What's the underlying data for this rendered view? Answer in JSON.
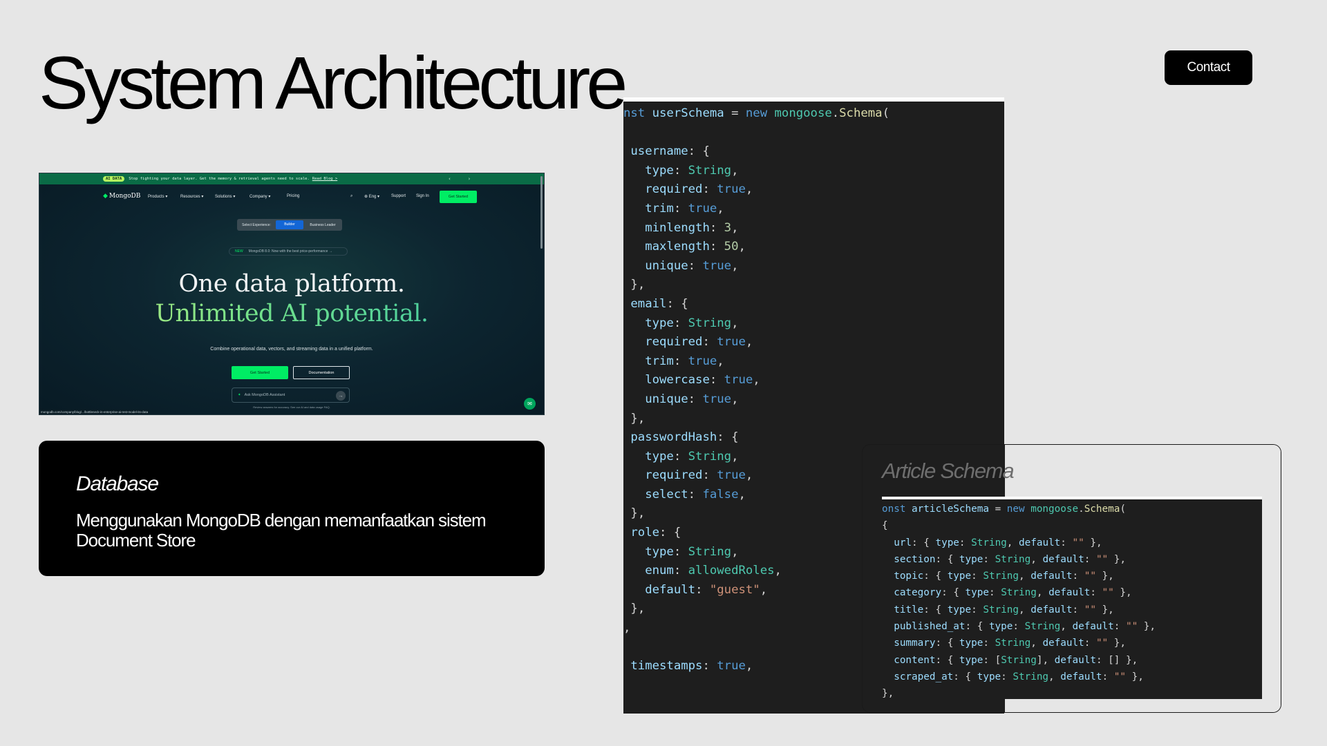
{
  "slide": {
    "title": "System Architecture",
    "contact_label": "Contact"
  },
  "mongodb_screenshot": {
    "banner_pill": "AI DATA",
    "banner_text": "Stop fighting your data layer. Get the memory & retrieval agents need to scale.",
    "banner_link": "Read Blog >",
    "banner_arrows": "‹ ›",
    "logo": "MongoDB",
    "nav_items": [
      "Products ▾",
      "Resources ▾",
      "Solutions ▾",
      "Company ▾",
      "Pricing"
    ],
    "nav_right": [
      "⌕",
      "⊕ Eng ▾",
      "Support",
      "Sign In"
    ],
    "nav_cta": "Get Started",
    "toggle": [
      "Select Experience:",
      "Builder",
      "Business Leader"
    ],
    "news_tag": "NEW",
    "news_text": "MongoDB 8.0: Now with the best price-performance →",
    "headline_1": "One data platform.",
    "headline_2": "Unlimited AI potential.",
    "subheadline": "Combine operational data, vectors, and streaming data in a unified platform.",
    "primary_button": "Get Started",
    "secondary_button": "Documentation",
    "ask_placeholder": "Ask MongoDB Assistant",
    "ask_send": "→",
    "disclaimer": "Review answers for accuracy. See our AI and data usage FAQ.",
    "status_url": "mongodb.com/company/blog/.../bottleneck-in-enterprise-ai-rest-model-its-data",
    "chat_icon": "chat-bubble-icon"
  },
  "database_card": {
    "title": "Database",
    "description": "Menggunakan MongoDB dengan memanfaatkan sistem Document Store"
  },
  "user_schema_code": [
    "nst userSchema = new mongoose.Schema(",
    "",
    " username: {",
    "   type: String,",
    "   required: true,",
    "   trim: true,",
    "   minlength: 3,",
    "   maxlength: 50,",
    "   unique: true,",
    " },",
    " email: {",
    "   type: String,",
    "   required: true,",
    "   trim: true,",
    "   lowercase: true,",
    "   unique: true,",
    " },",
    " passwordHash: {",
    "   type: String,",
    "   required: true,",
    "   select: false,",
    " },",
    " role: {",
    "   type: String,",
    "   enum: allowedRoles,",
    "   default: \"guest\",",
    " },",
    ",",
    "",
    " timestamps: true,"
  ],
  "article_card": {
    "title": "Article Schema",
    "code": [
      "onst articleSchema = new mongoose.Schema(",
      "{",
      "  url: { type: String, default: \"\" },",
      "  section: { type: String, default: \"\" },",
      "  topic: { type: String, default: \"\" },",
      "  category: { type: String, default: \"\" },",
      "  title: { type: String, default: \"\" },",
      "  published_at: { type: String, default: \"\" },",
      "  summary: { type: String, default: \"\" },",
      "  content: { type: [String], default: [] },",
      "  scraped_at: { type: String, default: \"\" },",
      "},"
    ]
  },
  "colors": {
    "background": "#e6e6e6",
    "mongodb_green": "#00ed64",
    "code_background": "#1e1e1e"
  }
}
